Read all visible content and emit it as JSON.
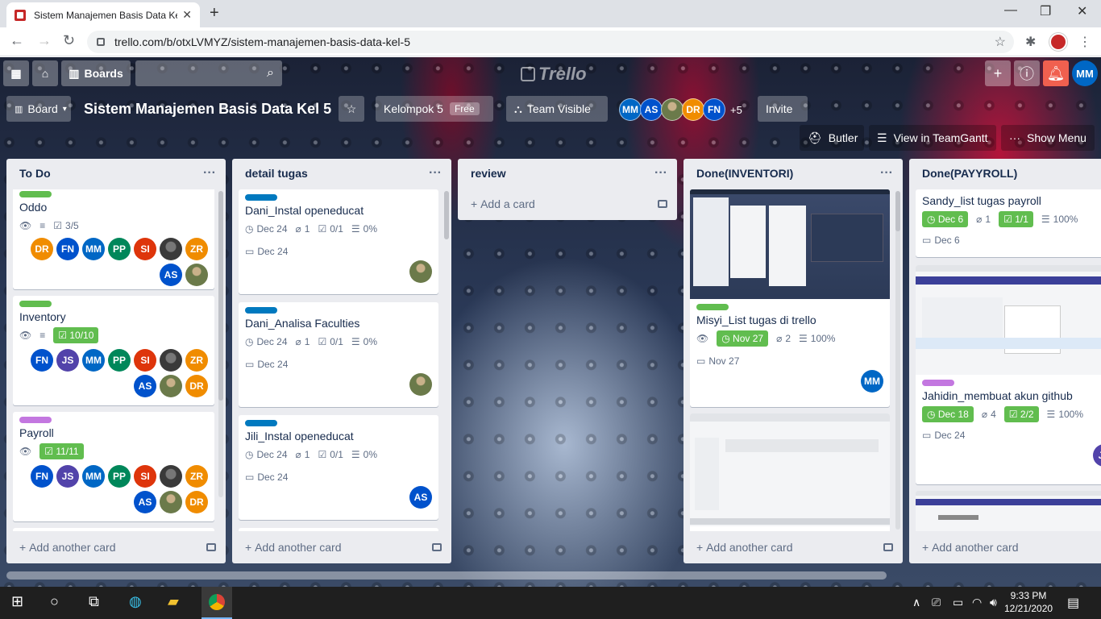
{
  "browser": {
    "tab_title": "Sistem Manajemen Basis Data Kel",
    "url": "trello.com/b/otxLVMYZ/sistem-manajemen-basis-data-kel-5"
  },
  "trello": {
    "boards_label": "Boards",
    "logo_text": "Trello",
    "user_initials": "MM",
    "board_menu_label": "Board",
    "board_title": "Sistem Manajemen Basis Data Kel 5",
    "team_name": "Kelompok 5",
    "team_badge": "Free",
    "visibility_label": "Team Visible",
    "members": [
      {
        "initials": "MM",
        "color": "#0067c5"
      },
      {
        "initials": "AS",
        "color": "#0052cc"
      },
      {
        "initials": "",
        "color": "#6b7a4a"
      },
      {
        "initials": "DR",
        "color": "#f08c00"
      },
      {
        "initials": "FN",
        "color": "#0052cc"
      }
    ],
    "members_more": "+5",
    "invite_label": "Invite",
    "butler_label": "Butler",
    "teamgantt_label": "View in TeamGantt",
    "show_menu_label": "Show Menu",
    "add_another_card": "Add another card",
    "add_a_card": "Add a card"
  },
  "lists": [
    {
      "name": "To Do",
      "cards": [
        {
          "title": "Oddo",
          "label": "#61bd4f",
          "checklist": "3/5",
          "avatars": [
            "DR",
            "FN",
            "MM",
            "PP",
            "SI",
            "img",
            "ZR",
            "AS",
            "img"
          ]
        },
        {
          "title": "Inventory",
          "label": "#61bd4f",
          "checklist": "10/10",
          "avatars": [
            "FN",
            "JS",
            "MM",
            "PP",
            "SI",
            "img",
            "ZR",
            "AS",
            "img",
            "DR"
          ]
        },
        {
          "title": "Payroll",
          "label": "#c377e0",
          "checklist": "11/11",
          "avatars": [
            "FN",
            "JS",
            "MM",
            "PP",
            "SI",
            "img",
            "ZR",
            "AS",
            "img",
            "DR"
          ]
        }
      ]
    },
    {
      "name": "detail tugas",
      "cards": [
        {
          "title": "Dani_Instal openeducat",
          "label": "#0079bf",
          "due": "Dec 24",
          "attach": "1",
          "check": "0/1",
          "pct": "0%",
          "start": "Dec 24",
          "avatar": "img"
        },
        {
          "title": "Dani_Analisa Faculties",
          "label": "#0079bf",
          "due": "Dec 24",
          "attach": "1",
          "check": "0/1",
          "pct": "0%",
          "start": "Dec 24",
          "avatar": "img"
        },
        {
          "title": "Jili_Instal openeducat",
          "label": "#0079bf",
          "due": "Dec 24",
          "attach": "1",
          "check": "0/1",
          "pct": "0%",
          "start": "Dec 24",
          "avatar": "AS"
        }
      ]
    },
    {
      "name": "review",
      "cards": []
    },
    {
      "name": "Done(INVENTORI)",
      "cards": [
        {
          "title": "Misyi_List tugas di trello",
          "label": "#61bd4f",
          "due": "Nov 27",
          "attach": "2",
          "pct": "100%",
          "start": "Nov 27",
          "avatar": "MM"
        }
      ]
    },
    {
      "name": "Done(PAYYROLL)",
      "cards": [
        {
          "title": "Sandy_list tugas payroll",
          "due": "Dec 6",
          "attach": "1",
          "check": "1/1",
          "pct": "100%",
          "start": "Dec 6"
        },
        {
          "title": "Jahidin_membuat akun github",
          "label": "#c377e0",
          "due": "Dec 18",
          "attach": "4",
          "check": "2/2",
          "pct": "100%",
          "start": "Dec 24",
          "avatar": "JS"
        }
      ]
    }
  ],
  "avatar_colors": {
    "DR": "#f08c00",
    "FN": "#0052cc",
    "MM": "#0067c5",
    "PP": "#00875a",
    "SI": "#de350b",
    "ZR": "#f08c00",
    "AS": "#0052cc",
    "JS": "#5243aa"
  },
  "taskbar": {
    "time": "9:33 PM",
    "date": "12/21/2020"
  }
}
